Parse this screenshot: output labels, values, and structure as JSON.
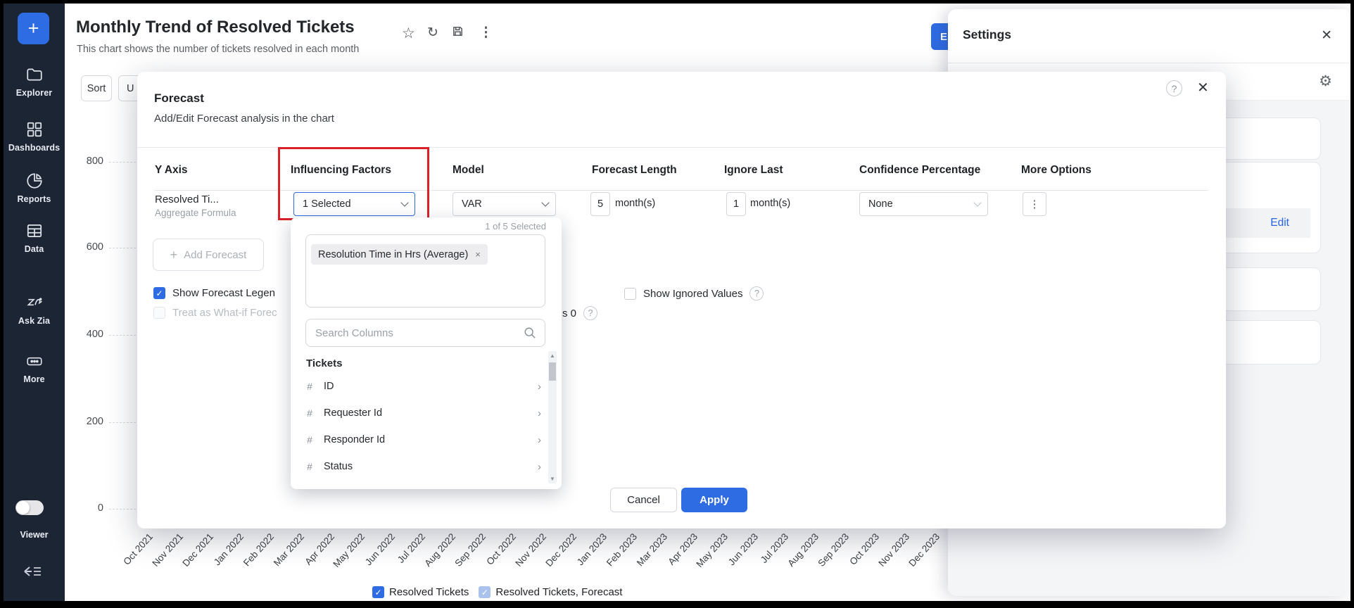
{
  "sidebar": {
    "plus_button": "+",
    "items": [
      {
        "label": "Explorer",
        "icon": "folder-icon"
      },
      {
        "label": "Dashboards",
        "icon": "grid-icon"
      },
      {
        "label": "Reports",
        "icon": "pie-chart-icon"
      },
      {
        "label": "Data",
        "icon": "table-icon"
      },
      {
        "label": "Ask Zia",
        "icon": "zia-icon"
      },
      {
        "label": "More",
        "icon": "ellipsis-icon"
      }
    ],
    "viewer_toggle_label": "Viewer"
  },
  "header": {
    "title": "Monthly Trend of Resolved Tickets",
    "subtitle": "This chart shows the number of tickets resolved in each month",
    "edit_button_visible_text": "E"
  },
  "toolbar": {
    "sort_label": "Sort",
    "partial_button_visible_text": "U"
  },
  "chart_data": {
    "type": "line",
    "title": "Monthly Trend of Resolved Tickets",
    "x_categories": [
      "Oct 2021",
      "Nov 2021",
      "Dec 2021",
      "Jan 2022",
      "Feb 2022",
      "Mar 2022",
      "Apr 2022",
      "May 2022",
      "Jun 2022",
      "Jul 2022",
      "Aug 2022",
      "Sep 2022",
      "Oct 2022",
      "Nov 2022",
      "Dec 2022",
      "Jan 2023",
      "Feb 2023",
      "Mar 2023",
      "Apr 2023",
      "May 2023",
      "Jun 2023",
      "Jul 2023",
      "Aug 2023",
      "Sep 2023",
      "Oct 2023",
      "Nov 2023",
      "Dec 2023"
    ],
    "y_ticks": [
      "800",
      "600",
      "400",
      "200",
      "0"
    ],
    "ylim": [
      0,
      800
    ],
    "grid": "dashed-horizontal",
    "series": [
      {
        "name": "Resolved Tickets"
      },
      {
        "name": "Resolved Tickets, Forecast"
      }
    ],
    "plot_area_visible": false
  },
  "legend": {
    "items": [
      {
        "label": "Resolved Tickets",
        "checked": true,
        "color": "#2e6ce4"
      },
      {
        "label": "Resolved Tickets, Forecast",
        "checked": true,
        "color": "#a9c3ec"
      }
    ]
  },
  "modal": {
    "title": "Forecast",
    "subtitle": "Add/Edit Forecast analysis in the chart",
    "columns": [
      "Y Axis",
      "Influencing Factors",
      "Model",
      "Forecast Length",
      "Ignore Last",
      "Confidence Percentage",
      "More Options"
    ],
    "row": {
      "y_axis": "Resolved Ti...",
      "y_axis_sub": "Aggregate Formula",
      "influencing_factors": "1 Selected",
      "model": "VAR",
      "forecast_length": "5",
      "forecast_length_unit": "month(s)",
      "ignore_last": "1",
      "ignore_last_unit": "month(s)",
      "confidence": "None",
      "more_options_icon": "kebab-icon"
    },
    "add_forecast_label": "Add Forecast",
    "checkboxes": {
      "show_forecast_legend_visible": "Show Forecast Legen",
      "treat_what_if_visible": "Treat as What-if Forec",
      "missing_values_visible": "s 0",
      "show_ignored_values": "Show Ignored Values"
    },
    "cancel_label": "Cancel",
    "apply_label": "Apply"
  },
  "factor_dropdown": {
    "count_label": "1 of 5 Selected",
    "chip": "Resolution Time in Hrs (Average)",
    "chip_remove": "×",
    "search_placeholder": "Search Columns",
    "group": "Tickets",
    "items": [
      "ID",
      "Requester Id",
      "Responder Id",
      "Status"
    ]
  },
  "settings_panel": {
    "title": "Settings",
    "edit_link": "Edit"
  },
  "colors": {
    "accent_blue": "#2e6ce4",
    "sidebar_bg": "#1b2534",
    "highlight_red": "#da2128",
    "panel_body_gray": "#f4f5f7"
  }
}
